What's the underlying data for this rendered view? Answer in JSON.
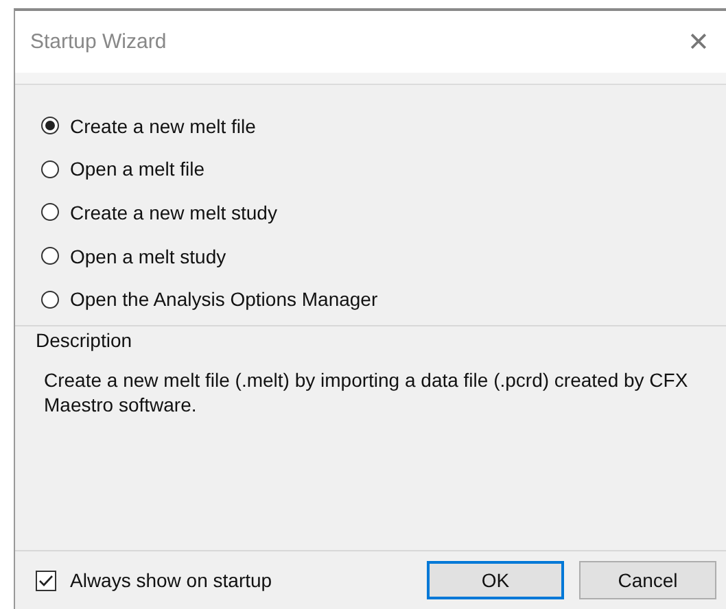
{
  "window": {
    "title": "Startup Wizard",
    "close": "✕"
  },
  "options": [
    {
      "label": "Create a new melt file",
      "selected": true
    },
    {
      "label": "Open a melt file",
      "selected": false
    },
    {
      "label": "Create a new melt study",
      "selected": false
    },
    {
      "label": "Open a melt study",
      "selected": false
    },
    {
      "label": "Open the Analysis Options Manager",
      "selected": false
    }
  ],
  "description": {
    "heading": "Description",
    "text": "Create a new melt file (.melt) by importing a data file (.pcrd) created by CFX Maestro software."
  },
  "always_show": {
    "label": "Always show on startup",
    "checked": true
  },
  "buttons": [
    {
      "label": "OK",
      "default": true
    },
    {
      "label": "Cancel",
      "default": false
    }
  ]
}
